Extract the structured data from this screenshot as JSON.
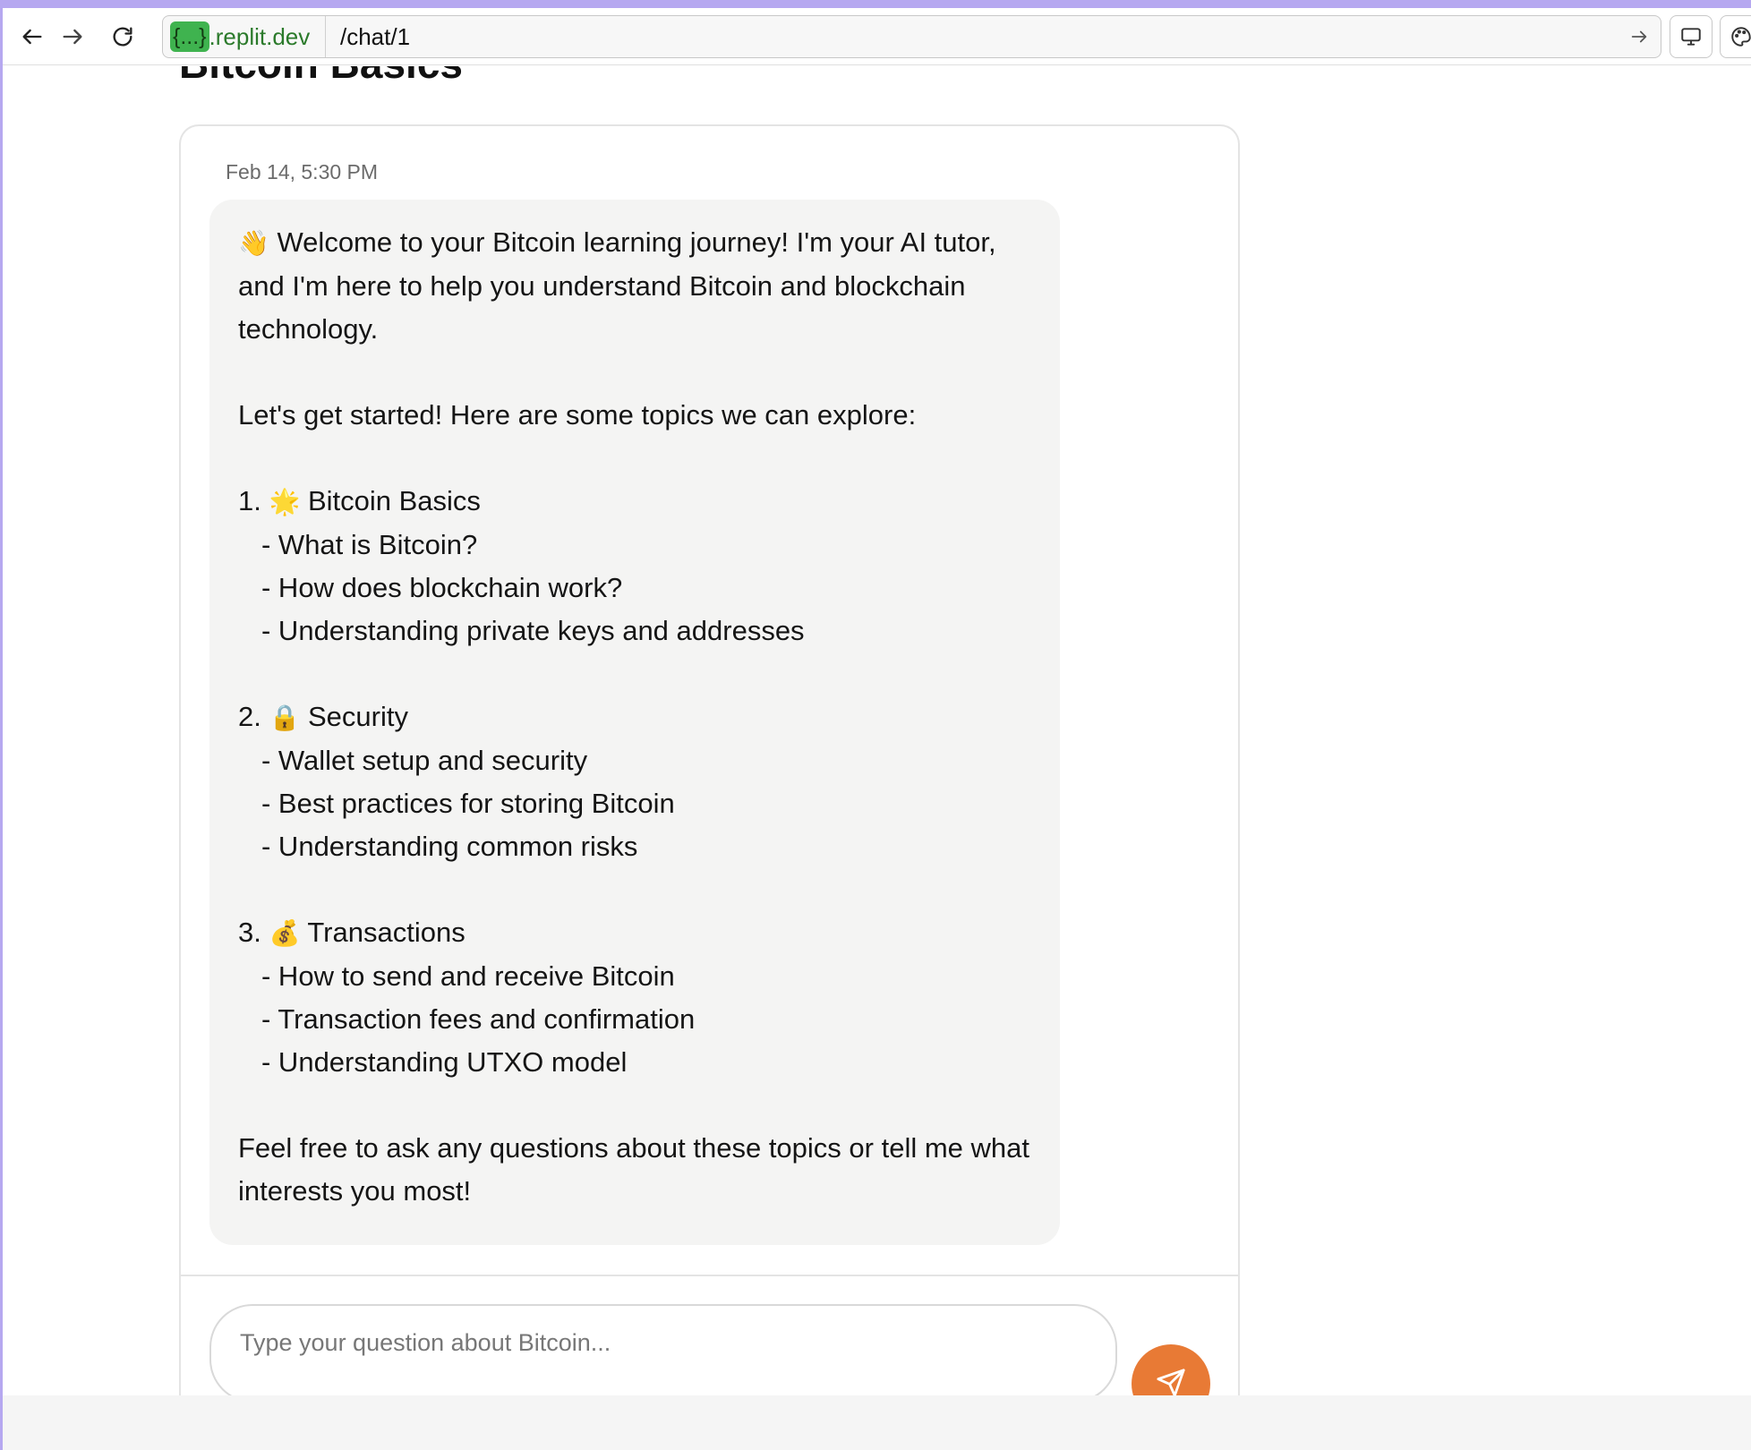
{
  "browser": {
    "host_badge": "{...}",
    "host_rest": ".replit.dev",
    "path": "/chat/1"
  },
  "page": {
    "title": "Bitcoin Basics"
  },
  "chat": {
    "timestamp": "Feb 14, 5:30 PM",
    "message": {
      "intro_emoji": "👋",
      "intro": " Welcome to your Bitcoin learning journey! I'm your AI tutor, and I'm here to help you understand Bitcoin and blockchain technology.",
      "lead": "Let's get started! Here are some topics we can explore:",
      "sections": [
        {
          "number": "1. ",
          "emoji": "🌟",
          "title": " Bitcoin Basics",
          "items": [
            "- What is Bitcoin?",
            "- How does blockchain work?",
            "- Understanding private keys and addresses"
          ]
        },
        {
          "number": "2. ",
          "emoji": "🔒",
          "title": " Security",
          "items": [
            "- Wallet setup and security",
            "- Best practices for storing Bitcoin",
            "- Understanding common risks"
          ]
        },
        {
          "number": "3. ",
          "emoji": "💰",
          "title": " Transactions",
          "items": [
            "- How to send and receive Bitcoin",
            "- Transaction fees and confirmation",
            "- Understanding UTXO model"
          ]
        }
      ],
      "closing": "Feel free to ask any questions about these topics or tell me what interests you most!"
    },
    "input": {
      "placeholder": "Type your question about Bitcoin...",
      "value": ""
    }
  },
  "colors": {
    "accent_send": "#e87a35",
    "bubble_bg": "#f4f4f3",
    "window_accent": "#b6a8f0",
    "host_badge": "#3fb34f"
  },
  "icons": {
    "back": "arrow-left-icon",
    "forward": "arrow-right-icon",
    "reload": "reload-icon",
    "go": "arrow-right-icon",
    "devices": "monitor-icon",
    "theme": "palette-icon",
    "send": "send-icon"
  }
}
